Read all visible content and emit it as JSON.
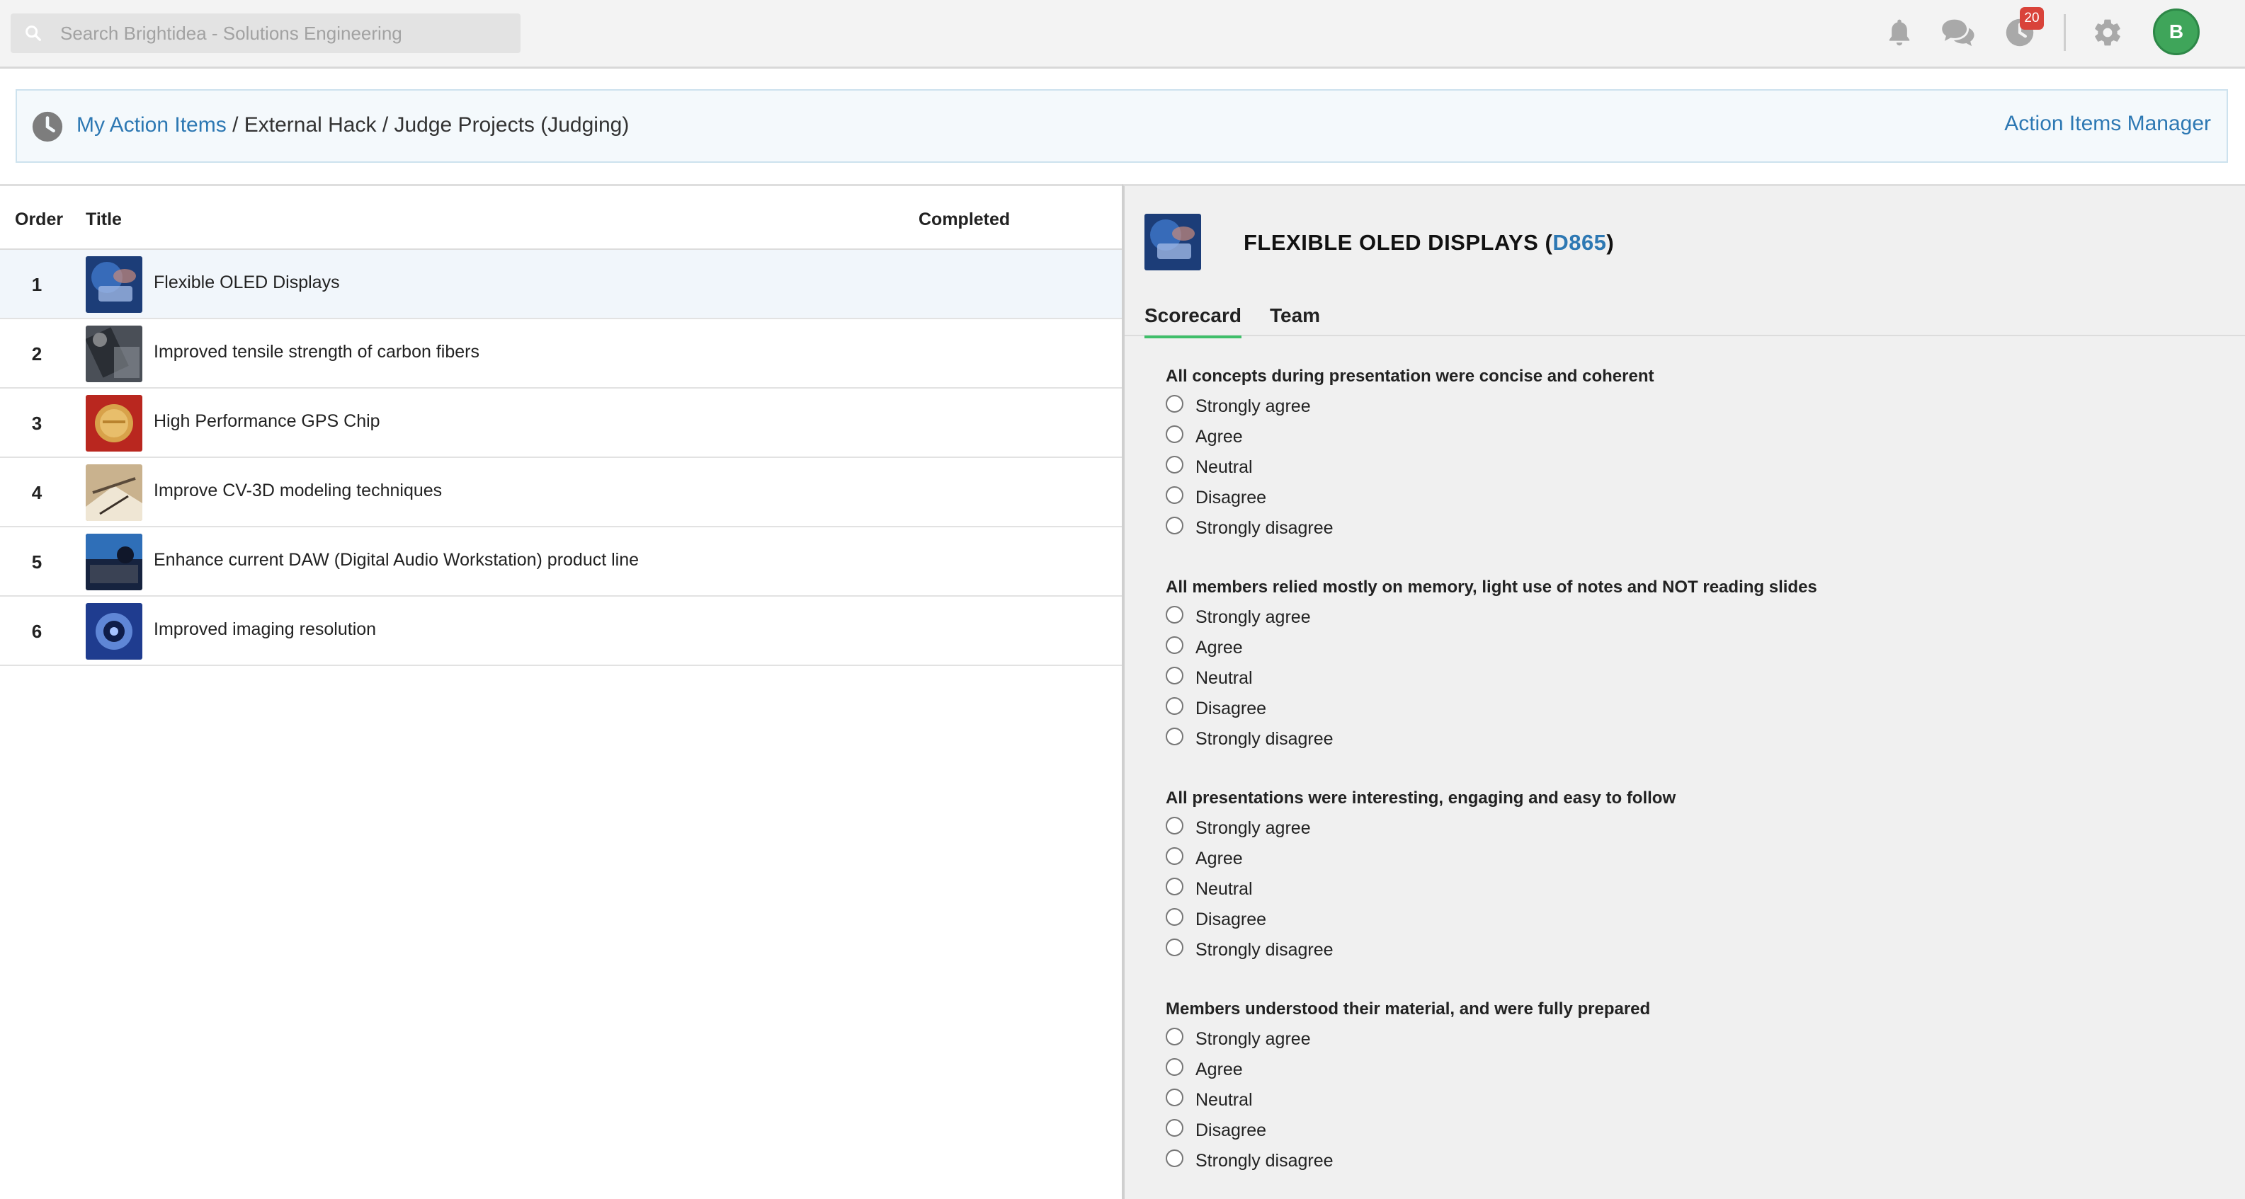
{
  "header": {
    "search_placeholder": "Search Brightidea - Solutions Engineering",
    "notification_badge": "20",
    "avatar_initial": "B"
  },
  "breadcrumb": {
    "root": "My Action Items",
    "rest": " / External Hack / Judge Projects (Judging)",
    "manager_link": "Action Items Manager"
  },
  "table": {
    "columns": {
      "order": "Order",
      "title": "Title",
      "completed": "Completed"
    },
    "rows": [
      {
        "order": "1",
        "title": "Flexible OLED Displays",
        "thumb": "blue-hands"
      },
      {
        "order": "2",
        "title": "Improved tensile strength of carbon fibers",
        "thumb": "dark-fiber"
      },
      {
        "order": "3",
        "title": "High Performance GPS Chip",
        "thumb": "red-gold-coin"
      },
      {
        "order": "4",
        "title": "Improve CV-3D modeling techniques",
        "thumb": "tan-sketch"
      },
      {
        "order": "5",
        "title": "Enhance current DAW (Digital Audio Workstation) product line",
        "thumb": "blue-audio"
      },
      {
        "order": "6",
        "title": "Improved imaging resolution",
        "thumb": "blue-lens"
      }
    ]
  },
  "detail": {
    "title": "FLEXIBLE OLED DISPLAYS",
    "code": "D865",
    "tabs": [
      "Scorecard",
      "Team"
    ],
    "active_tab": "Scorecard",
    "questions": [
      {
        "text": "All concepts during presentation were concise and coherent",
        "options": [
          "Strongly agree",
          "Agree",
          "Neutral",
          "Disagree",
          "Strongly disagree"
        ]
      },
      {
        "text": "All members relied mostly on memory, light use of notes and NOT reading slides",
        "options": [
          "Strongly agree",
          "Agree",
          "Neutral",
          "Disagree",
          "Strongly disagree"
        ]
      },
      {
        "text": "All presentations were interesting, engaging and easy to follow",
        "options": [
          "Strongly agree",
          "Agree",
          "Neutral",
          "Disagree",
          "Strongly disagree"
        ]
      },
      {
        "text": "Members understood their material, and were fully prepared",
        "options": [
          "Strongly agree",
          "Agree",
          "Neutral",
          "Disagree",
          "Strongly disagree"
        ]
      }
    ]
  },
  "colors": {
    "link_blue": "#2d78b3",
    "avatar_green": "#3fa55a",
    "badge_red": "#d9433a",
    "tab_underline": "#3fbf6a"
  }
}
